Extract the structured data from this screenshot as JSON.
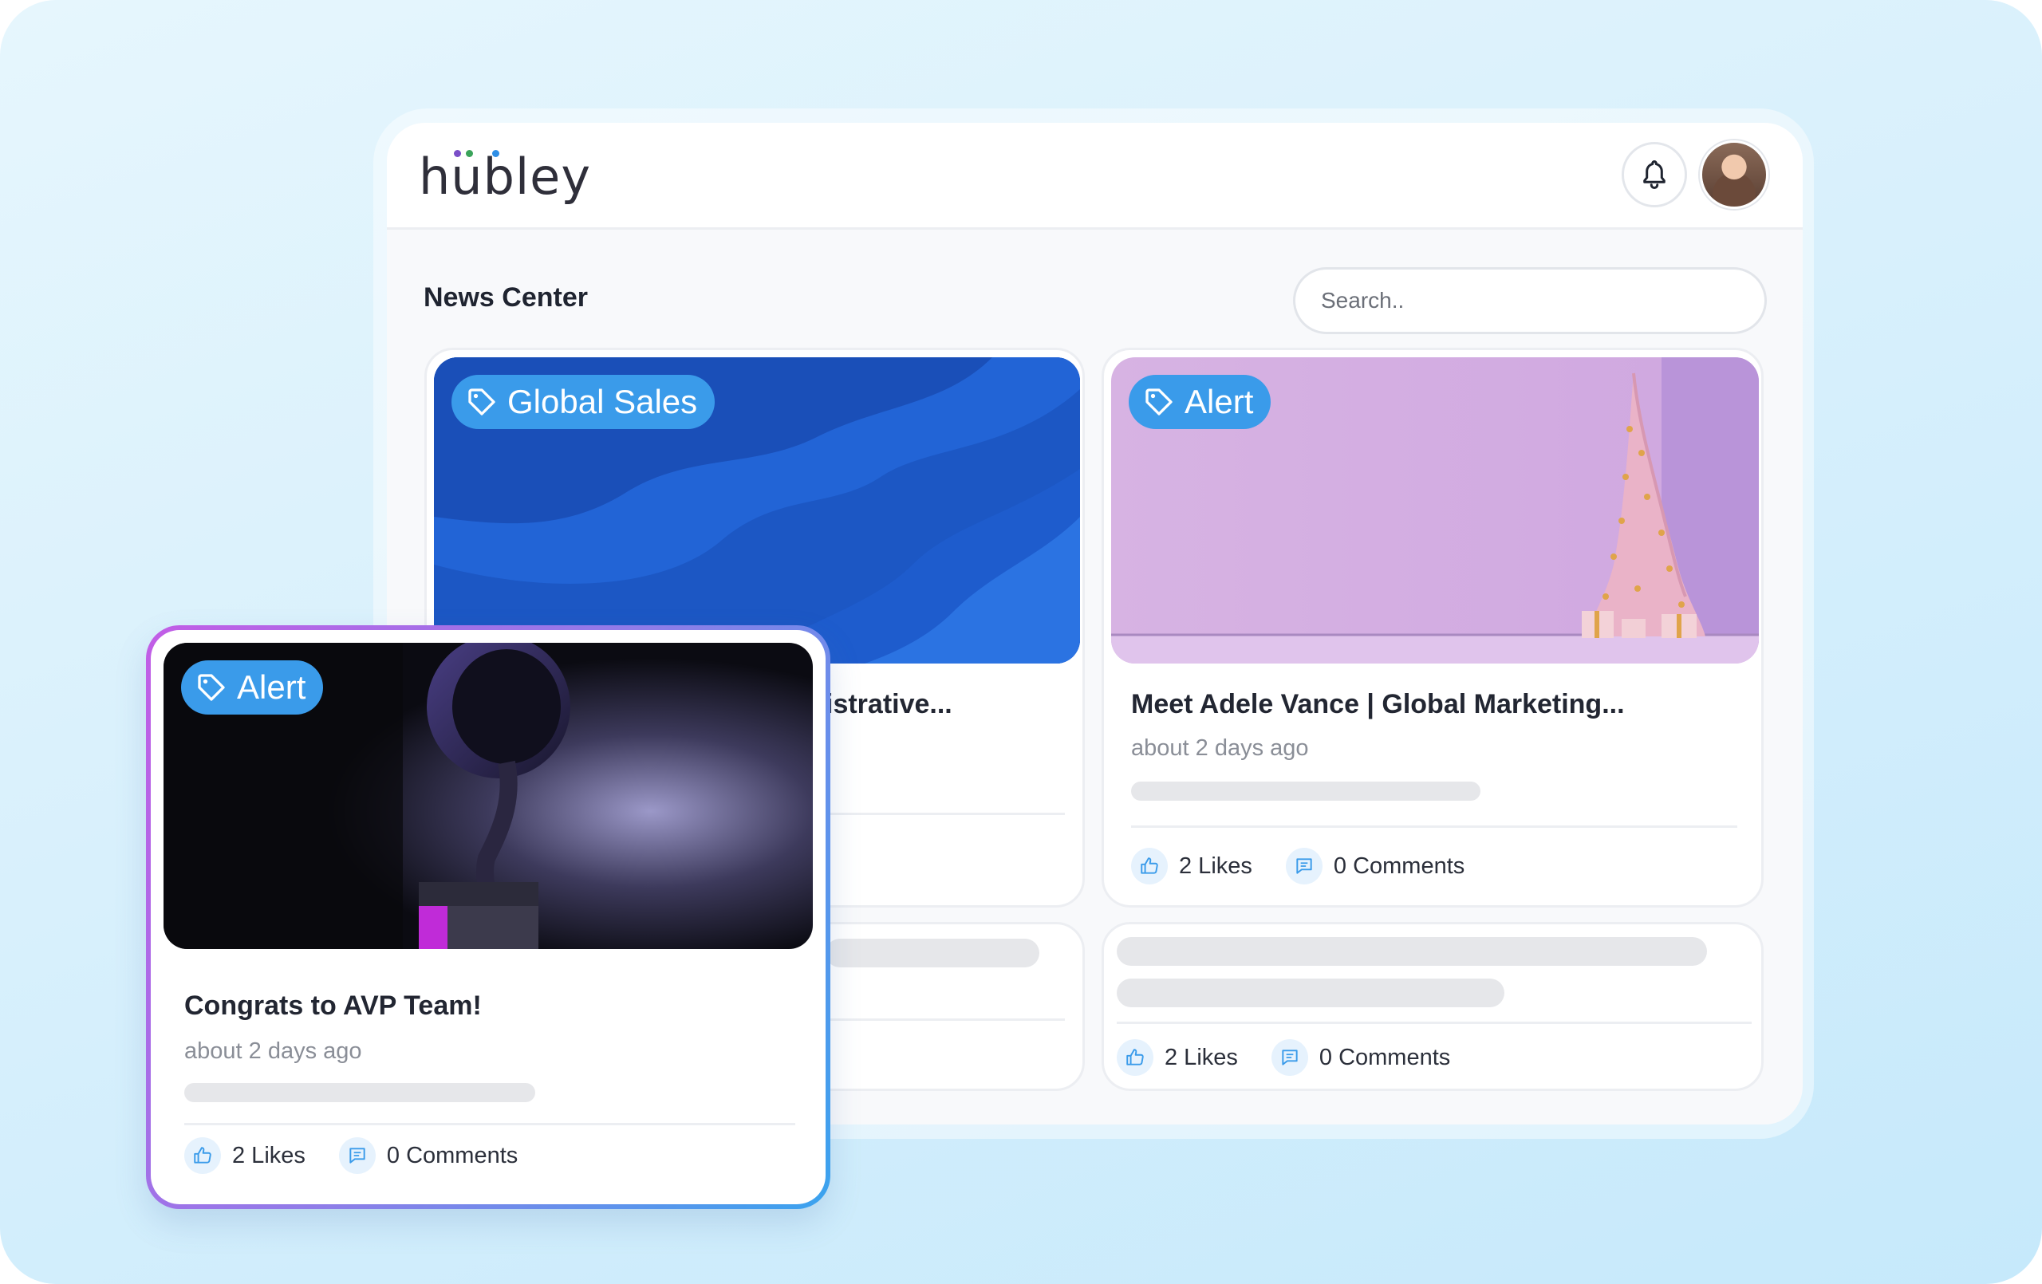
{
  "app": {
    "logo_text": "hubley",
    "logo_dot_colors": [
      "#7a4fc8",
      "#3aa35a",
      "#2f8fe6"
    ]
  },
  "header": {
    "bell_icon": "bell-icon",
    "avatar_alt": "user-avatar"
  },
  "page": {
    "title": "News Center",
    "search_placeholder": "Search.."
  },
  "colors": {
    "tag_bg": "#3a9bea",
    "accent_blue": "#3a9bea",
    "border_gradient": [
      "#c25de6",
      "#3aa3ee"
    ]
  },
  "cards": [
    {
      "tag": "Global Sales",
      "title_visible_fragment": "istrative...",
      "image": "blue-waves"
    },
    {
      "tag": "Alert",
      "title": "Meet Adele Vance | Global Marketing...",
      "time": "about 2 days ago",
      "likes": "2 Likes",
      "comments": "0 Comments",
      "image": "pink-christmas-tree"
    },
    {
      "likes": "2 Likes",
      "comments": "0 Comments"
    }
  ],
  "featured_card": {
    "tag": "Alert",
    "title": "Congrats to AVP Team!",
    "time": "about 2 days ago",
    "likes": "2 Likes",
    "comments": "0 Comments",
    "image": "award-trophy"
  }
}
